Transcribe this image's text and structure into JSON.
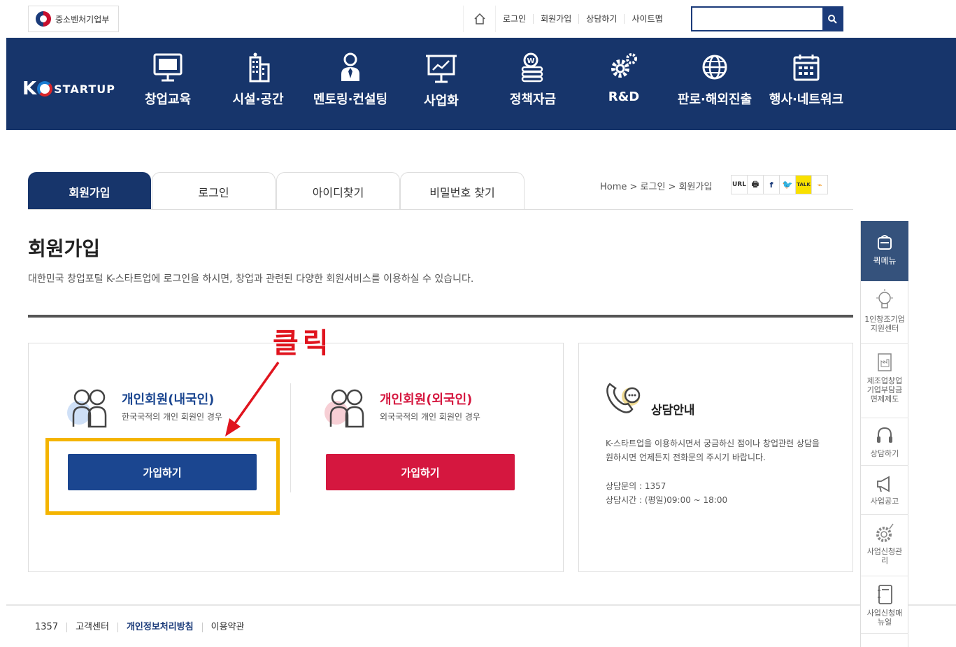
{
  "topbar": {
    "ministry": "중소벤처기업부",
    "links": [
      "로그인",
      "회원가입",
      "상담하기",
      "사이트맵"
    ],
    "search_placeholder": ""
  },
  "brand": {
    "k": "K",
    "word": "STARTUP"
  },
  "nav": [
    "창업교육",
    "시설·공간",
    "멘토링·컨설팅",
    "사업화",
    "정책자금",
    "R&D",
    "판로·해외진출",
    "행사·네트워크"
  ],
  "tabs": [
    "회원가입",
    "로그인",
    "아이디찾기",
    "비밀번호 찾기"
  ],
  "breadcrumb": "Home > 로그인 > 회원가입",
  "share": [
    "URL",
    "🖶",
    "f",
    "🐦",
    "TALK",
    "⌁"
  ],
  "page": {
    "title": "회원가입",
    "desc": "대한민국 창업포털 K-스타트업에 로그인을 하시면, 창업과 관련된 다양한 회원서비스를 이용하실 수 있습니다."
  },
  "members": [
    {
      "title": "개인회원(내국인)",
      "sub": "한국국적의 개인 회원인 경우",
      "button": "가입하기",
      "color": "#1b4690"
    },
    {
      "title": "개인회원(외국인)",
      "sub": "외국국적의 개인 회원인 경우",
      "button": "가입하기",
      "color": "#d5173f"
    }
  ],
  "annotation": {
    "text": "클릭",
    "color": "#e0141e",
    "box_color": "#f4b400"
  },
  "consult": {
    "title": "상담안내",
    "text": "K-스타트업을 이용하시면서 궁금하신 점이나 창업관련 상담을 원하시면 언제든지 전화문의 주시기 바랍니다.",
    "phone": "상담문의 : 1357",
    "hours": "상담시간 : (평일)09:00 ~ 18:00"
  },
  "footer": [
    "1357",
    "고객센터",
    "개인정보처리방침",
    "이용약관"
  ],
  "quick": {
    "head": "퀵메뉴",
    "items": [
      "1인창조기업지원센터",
      "제조업창업기업부담금면제제도",
      "상담하기",
      "사업공고",
      "사업신청관리",
      "사업신청매뉴얼"
    ]
  }
}
